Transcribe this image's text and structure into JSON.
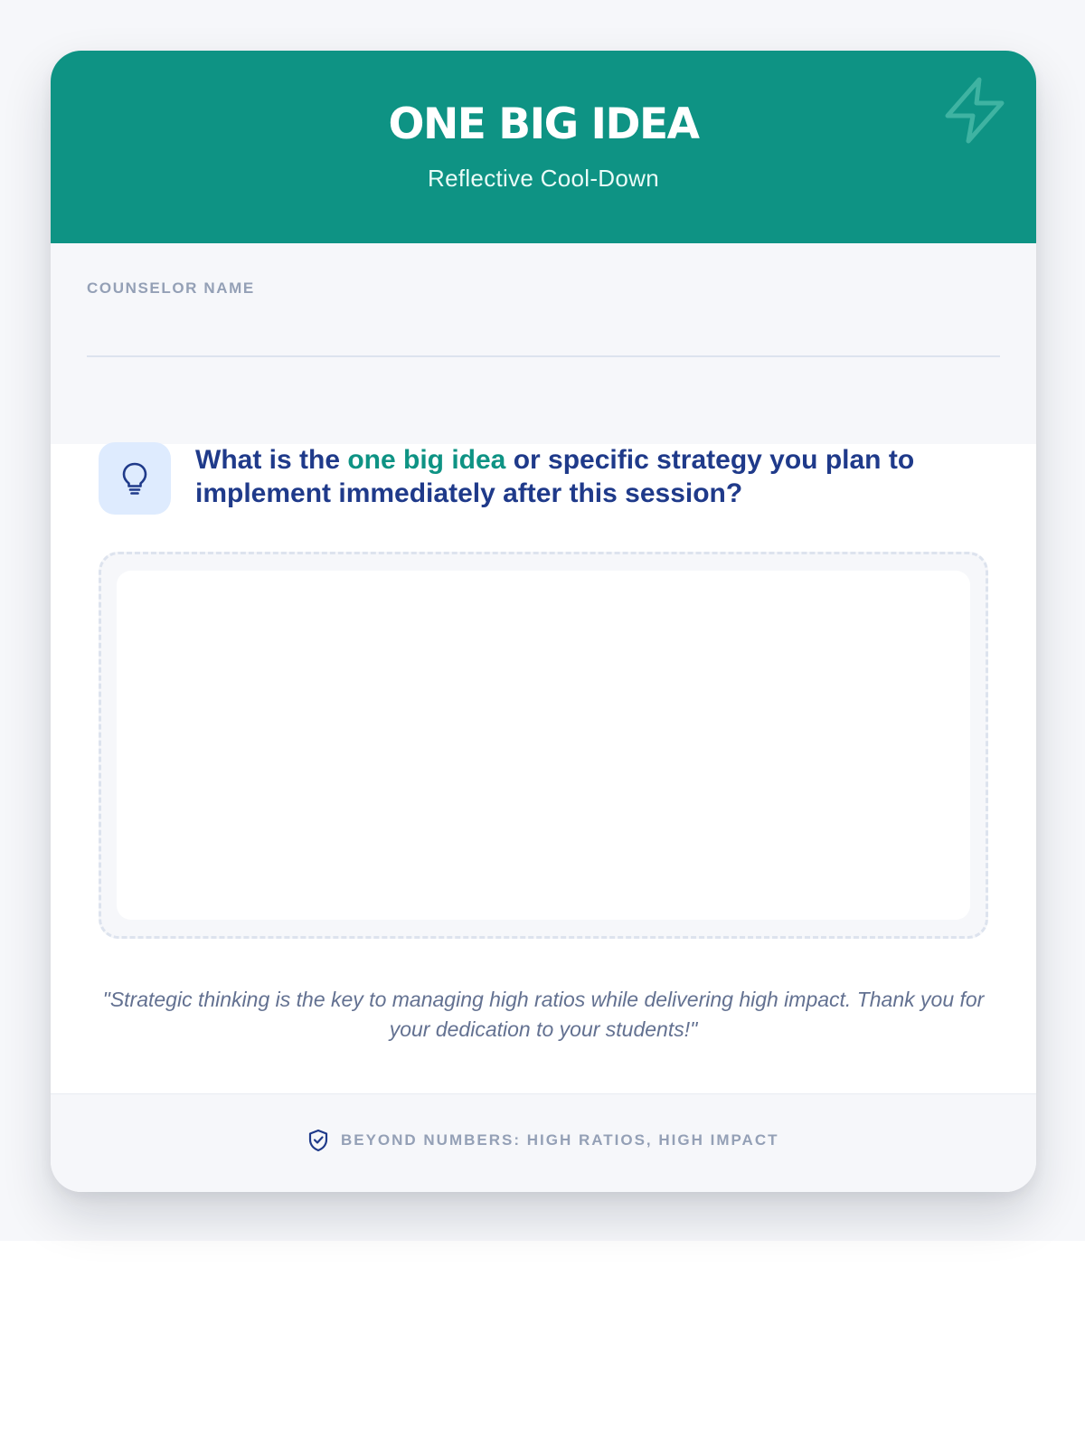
{
  "header": {
    "title": "ONE BIG IDEA",
    "subtitle": "Reflective Cool-Down",
    "icon": "lightning-bolt-icon"
  },
  "counselor": {
    "label": "COUNSELOR NAME",
    "value": "",
    "placeholder": ""
  },
  "question": {
    "icon": "lightbulb-icon",
    "before": "What is the ",
    "highlight": "one big idea",
    "after": " or specific strategy you plan to implement immediately after this session?"
  },
  "answer": {
    "value": "",
    "placeholder": ""
  },
  "quote": "\"Strategic thinking is the key to managing high ratios while delivering high impact. Thank you for your dedication to your students!\"",
  "footer": {
    "icon": "shield-check-icon",
    "text": "BEYOND NUMBERS: HIGH RATIOS, HIGH IMPACT"
  },
  "colors": {
    "brand_teal": "#0e9384",
    "heading_navy": "#1f3a8a",
    "muted_label": "#94a0b6",
    "icon_tile_bg": "#deebfe"
  }
}
